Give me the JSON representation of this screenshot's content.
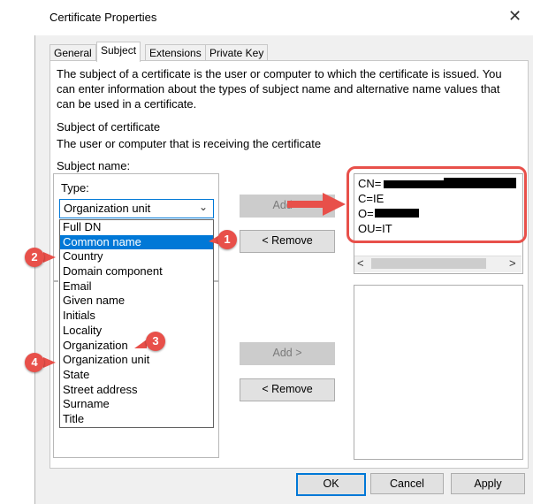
{
  "window": {
    "title": "Certificate Properties",
    "close_glyph": "✕"
  },
  "tabs": [
    {
      "label": "General",
      "active": false
    },
    {
      "label": "Subject",
      "active": true
    },
    {
      "label": "Extensions",
      "active": false
    },
    {
      "label": "Private Key",
      "active": false
    }
  ],
  "intro": {
    "line1": "The subject of a certificate is the user or computer to which the certificate is issued. You",
    "line2": "can enter information about the types of subject name and alternative name values that",
    "line3": "can be used in a certificate."
  },
  "subject_section": {
    "heading": "Subject of certificate",
    "description": "The user or computer that is receiving the certificate"
  },
  "subject_name": {
    "label": "Subject name:",
    "type_label": "Type:",
    "selected_value": "Organization unit",
    "options": [
      "Full DN",
      "Common name",
      "Country",
      "Domain component",
      "Email",
      "Given name",
      "Initials",
      "Locality",
      "Organization",
      "Organization unit",
      "State",
      "Street address",
      "Surname",
      "Title"
    ],
    "highlighted_option": "Common name"
  },
  "buttons": {
    "add_top": "Add >",
    "remove_top": "< Remove",
    "add_bottom": "Add >",
    "remove_bottom": "< Remove",
    "ok": "OK",
    "cancel": "Cancel",
    "apply": "Apply"
  },
  "subject_values": [
    "CN=",
    "C=IE",
    "O=",
    "OU=IT"
  ],
  "scroll": {
    "left_arrow": "<",
    "right_arrow": ">"
  },
  "badges": [
    "1",
    "2",
    "3",
    "4"
  ],
  "colors": {
    "accent": "#0078d7",
    "annotation_red": "#e8504a",
    "dialog_bg": "#f0f0f0"
  }
}
